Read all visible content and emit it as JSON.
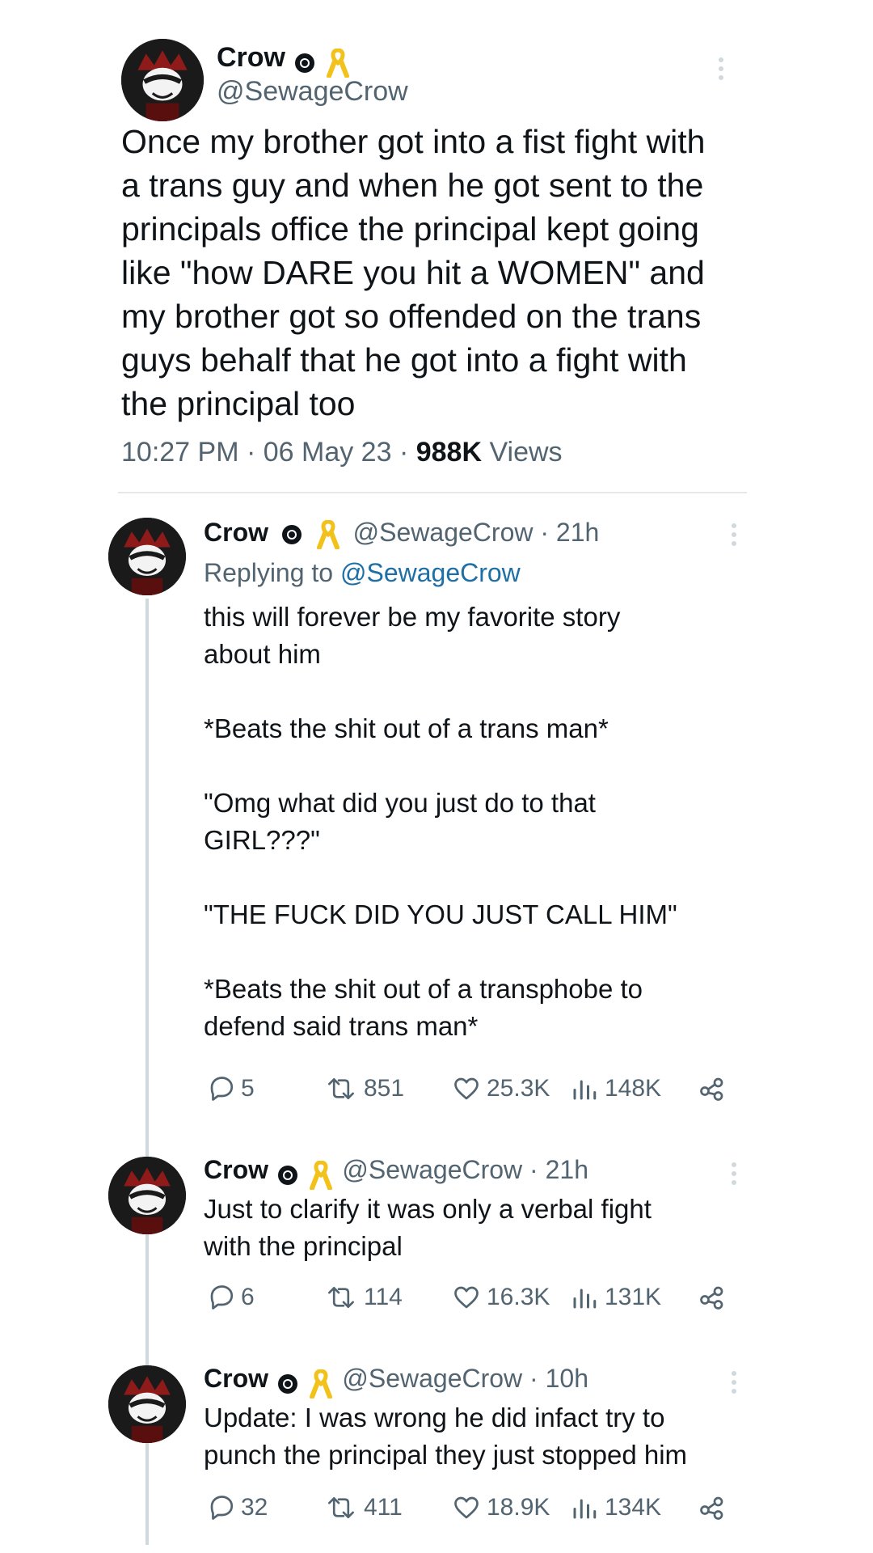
{
  "main_tweet": {
    "name": "Crow",
    "handle": "@SewageCrow",
    "text_lines": [
      "Once my brother got into a fist fight with",
      "a trans guy and when he got sent to the",
      "principals office the principal kept going",
      "like \"how DARE you hit a WOMEN\" and",
      "my brother got so offended on the trans",
      "guys behalf that he got into a fight with",
      "the principal too"
    ],
    "time": "10:27 PM · 06 May 23 · ",
    "views_count": "988K",
    "views_label": " Views"
  },
  "replies": [
    {
      "name": "Crow",
      "handle_time": "@SewageCrow · 21h",
      "replying_prefix": "Replying to ",
      "replying_handle": "@SewageCrow",
      "text": "this will forever be my favorite story\nabout him\n\n*Beats the shit out of a trans man*\n\n\"Omg what did you just do to that\nGIRL???\"\n\n\"THE FUCK DID YOU JUST CALL HIM\"\n\n*Beats the shit out of a transphobe to\ndefend said trans man*",
      "replies": "5",
      "retweets": "851",
      "likes": "25.3K",
      "views": "148K"
    },
    {
      "name": "Crow",
      "handle_time": "@SewageCrow · 21h",
      "text": "Just to clarify it was only a verbal fight\nwith the principal",
      "replies": "6",
      "retweets": "114",
      "likes": "16.3K",
      "views": "131K"
    },
    {
      "name": "Crow",
      "handle_time": "@SewageCrow · 10h",
      "text": "Update: I was wrong he did infact try to\npunch the principal they just stopped him",
      "replies": "32",
      "retweets": "411",
      "likes": "18.9K",
      "views": "134K"
    }
  ],
  "icons": {
    "ribbon_color": "#f2c21b",
    "thread_line_color": "#cfd9de",
    "link_color": "#1d6fa5"
  }
}
